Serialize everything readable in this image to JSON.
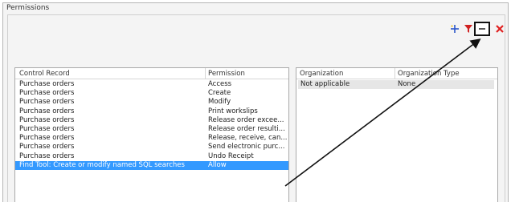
{
  "group": {
    "title": "Permissions"
  },
  "toolbar": {
    "icons": [
      "add-icon",
      "filter-icon",
      "minus-icon",
      "delete-icon"
    ]
  },
  "left_table": {
    "columns": [
      "Control Record",
      "Permission"
    ],
    "rows": [
      {
        "control_record": "Purchase orders",
        "permission": "Access"
      },
      {
        "control_record": "Purchase orders",
        "permission": "Create"
      },
      {
        "control_record": "Purchase orders",
        "permission": "Modify"
      },
      {
        "control_record": "Purchase orders",
        "permission": "Print workslips"
      },
      {
        "control_record": "Purchase orders",
        "permission": "Release order excee..."
      },
      {
        "control_record": "Purchase orders",
        "permission": "Release order resulti..."
      },
      {
        "control_record": "Purchase orders",
        "permission": "Release, receive, can..."
      },
      {
        "control_record": "Purchase orders",
        "permission": "Send electronic purc..."
      },
      {
        "control_record": "Purchase orders",
        "permission": "Undo Receipt"
      },
      {
        "control_record": "Find Tool: Create or modify named SQL searches",
        "permission": "Allow"
      }
    ],
    "selected_index": 9
  },
  "right_table": {
    "columns": [
      "Organization",
      "Organization Type"
    ],
    "rows": [
      {
        "organization": "Not applicable",
        "organization_type": "None"
      }
    ]
  },
  "colors": {
    "selection": "#3399ff",
    "delete_red": "#e02020",
    "filter_red": "#d02020",
    "add_blue": "#2a55c8"
  }
}
